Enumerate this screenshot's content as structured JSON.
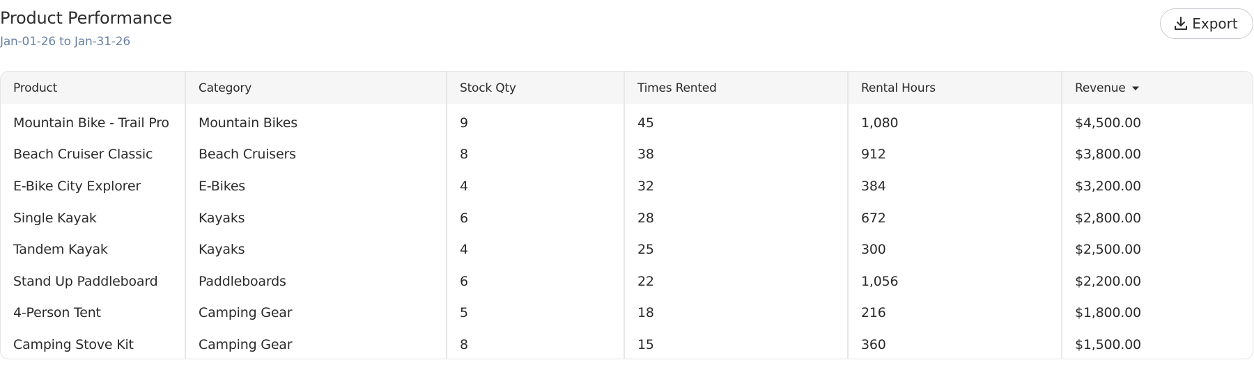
{
  "header": {
    "title": "Product Performance",
    "date_range": "Jan-01-26 to Jan-31-26"
  },
  "toolbar": {
    "export_label": "Export",
    "export_icon": "download-icon"
  },
  "table": {
    "columns": [
      "Product",
      "Category",
      "Stock Qty",
      "Times Rented",
      "Rental Hours",
      "Revenue"
    ],
    "sort": {
      "column": "Revenue",
      "direction": "descending",
      "icon": "sort-down-icon"
    },
    "rows": [
      [
        "Mountain Bike - Trail Pro",
        "Mountain Bikes",
        "9",
        "45",
        "1,080",
        "$4,500.00"
      ],
      [
        "Beach Cruiser Classic",
        "Beach Cruisers",
        "8",
        "38",
        "912",
        "$3,800.00"
      ],
      [
        "E-Bike City Explorer",
        "E-Bikes",
        "4",
        "32",
        "384",
        "$3,200.00"
      ],
      [
        "Single Kayak",
        "Kayaks",
        "6",
        "28",
        "672",
        "$2,800.00"
      ],
      [
        "Tandem Kayak",
        "Kayaks",
        "4",
        "25",
        "300",
        "$2,500.00"
      ],
      [
        "Stand Up Paddleboard",
        "Paddleboards",
        "6",
        "22",
        "1,056",
        "$2,200.00"
      ],
      [
        "4-Person Tent",
        "Camping Gear",
        "5",
        "18",
        "216",
        "$1,800.00"
      ],
      [
        "Camping Stove Kit",
        "Camping Gear",
        "8",
        "15",
        "360",
        "$1,500.00"
      ]
    ]
  },
  "colors": {
    "subtitle": "#6b83a3",
    "header_row_bg": "#f6f6f6",
    "border": "#e2e4e7"
  }
}
